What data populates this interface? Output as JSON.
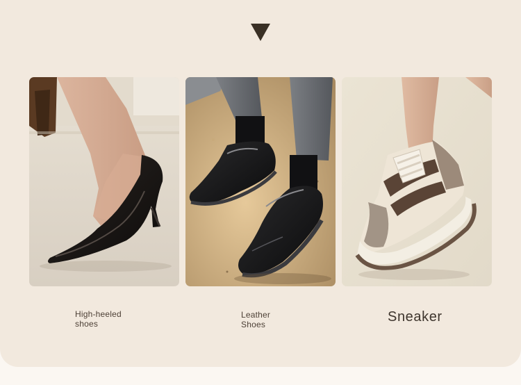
{
  "accent_color": "#3a3025",
  "panel_color": "#f2e9de",
  "categories": [
    {
      "label": "High-heeled shoes",
      "image": "black-patent-high-heel-pump"
    },
    {
      "label": "Leather Shoes",
      "image": "black-leather-oxford-shoes"
    },
    {
      "label": "Sneaker",
      "image": "grey-cream-chunky-sneaker"
    }
  ],
  "icons": {
    "pointer": "triangle-down-icon"
  }
}
